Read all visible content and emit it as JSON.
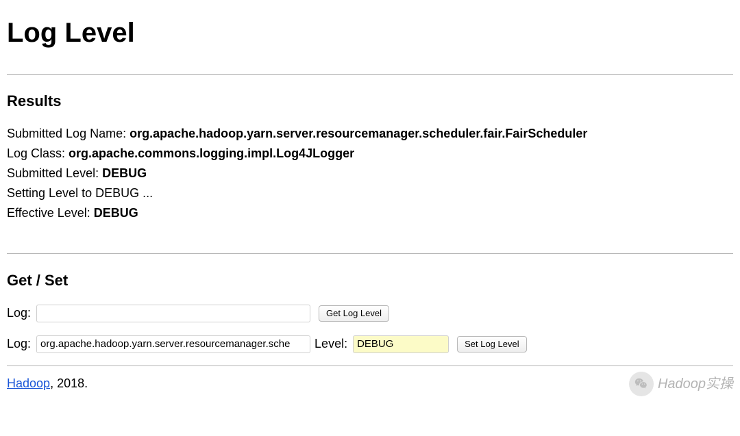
{
  "header": {
    "title": "Log Level"
  },
  "results": {
    "heading": "Results",
    "submitted_log_name_label": "Submitted Log Name: ",
    "submitted_log_name_value": "org.apache.hadoop.yarn.server.resourcemanager.scheduler.fair.FairScheduler",
    "log_class_label": "Log Class: ",
    "log_class_value": "org.apache.commons.logging.impl.Log4JLogger",
    "submitted_level_label": "Submitted Level: ",
    "submitted_level_value": "DEBUG",
    "setting_level_text": "Setting Level to DEBUG ...",
    "effective_level_label": "Effective Level: ",
    "effective_level_value": "DEBUG"
  },
  "getset": {
    "heading": "Get / Set",
    "get": {
      "log_label": "Log:",
      "log_value": "",
      "button_label": "Get Log Level"
    },
    "set": {
      "log_label": "Log:",
      "log_value": "org.apache.hadoop.yarn.server.resourcemanager.sche",
      "level_label": "Level:",
      "level_value": "DEBUG",
      "button_label": "Set Log Level"
    }
  },
  "footer": {
    "link_text": "Hadoop",
    "year_text": ", 2018."
  },
  "watermark": {
    "text": "Hadoop实操"
  }
}
